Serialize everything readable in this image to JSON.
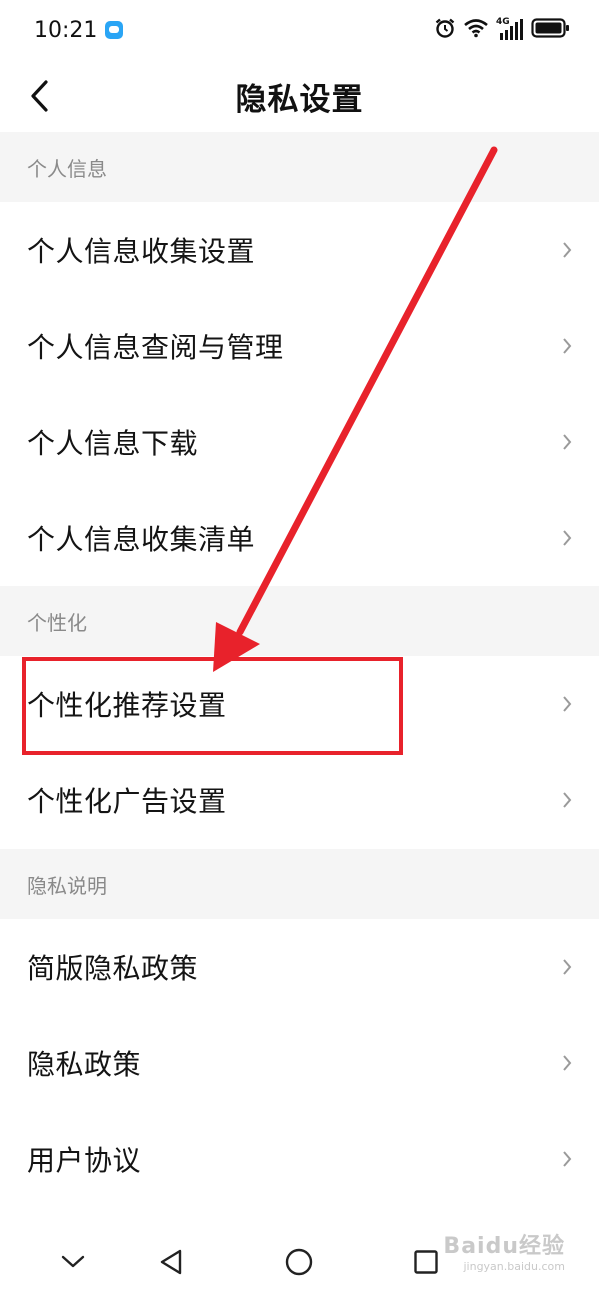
{
  "status_bar": {
    "time": "10:21",
    "network": "4G"
  },
  "header": {
    "title": "隐私设置"
  },
  "sections": [
    {
      "title": "个人信息",
      "items": [
        "个人信息收集设置",
        "个人信息查阅与管理",
        "个人信息下载",
        "个人信息收集清单"
      ]
    },
    {
      "title": "个性化",
      "items": [
        "个性化推荐设置",
        "个性化广告设置"
      ]
    },
    {
      "title": "隐私说明",
      "items": [
        "简版隐私政策",
        "隐私政策",
        "用户协议"
      ]
    }
  ],
  "annotation": {
    "highlighted_item": "个性化推荐设置",
    "color": "#e8222b"
  },
  "watermark": {
    "text": "Baidu经验",
    "sub": "jingyan.baidu.com"
  },
  "colors": {
    "section_bg": "#f5f5f5",
    "annotation": "#e8222b",
    "badge": "#2aa5f5"
  },
  "icons": {
    "back": "chevron-left-icon",
    "row": "chevron-right-icon",
    "nav": [
      "chevron-down-icon",
      "triangle-back-icon",
      "circle-home-icon",
      "square-recents-icon"
    ]
  }
}
